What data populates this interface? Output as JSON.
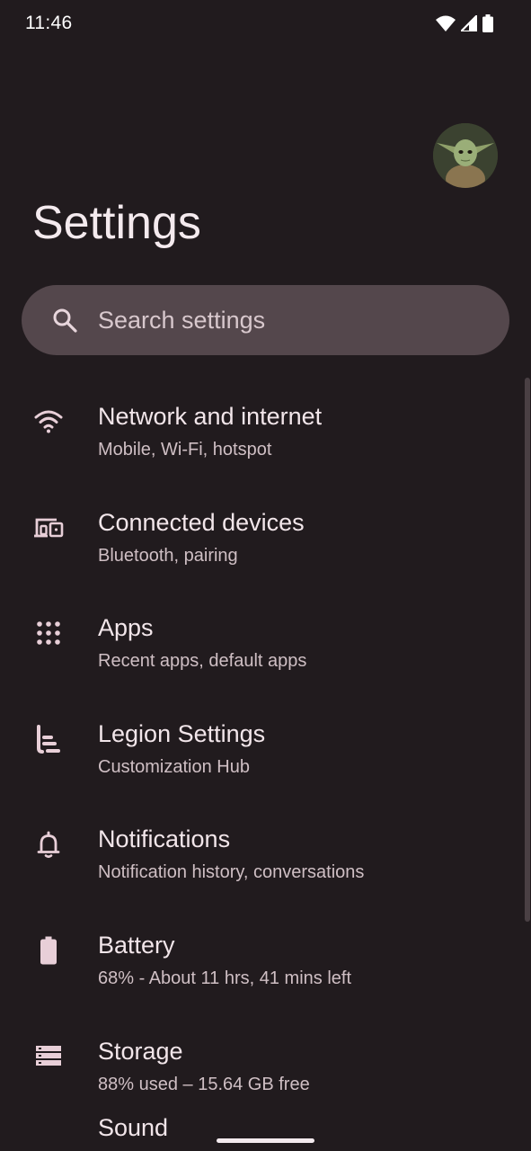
{
  "status_bar": {
    "time": "11:46"
  },
  "header": {
    "title": "Settings"
  },
  "search": {
    "placeholder": "Search settings"
  },
  "settings": [
    {
      "title": "Network and internet",
      "subtitle": "Mobile, Wi-Fi, hotspot",
      "icon": "wifi-icon"
    },
    {
      "title": "Connected devices",
      "subtitle": "Bluetooth, pairing",
      "icon": "devices-icon"
    },
    {
      "title": "Apps",
      "subtitle": "Recent apps, default apps",
      "icon": "apps-grid-icon"
    },
    {
      "title": "Legion Settings",
      "subtitle": "Customization Hub",
      "icon": "legion-icon"
    },
    {
      "title": "Notifications",
      "subtitle": "Notification history, conversations",
      "icon": "bell-icon"
    },
    {
      "title": "Battery",
      "subtitle": "68% - About 11 hrs, 41 mins left",
      "icon": "battery-icon"
    },
    {
      "title": "Storage",
      "subtitle": "88% used – 15.64 GB free",
      "icon": "storage-icon"
    }
  ],
  "partial_item": {
    "title": "Sound"
  },
  "colors": {
    "background": "#211b1e",
    "search_background": "#54474c",
    "icon_tint": "#e8cfd8"
  }
}
